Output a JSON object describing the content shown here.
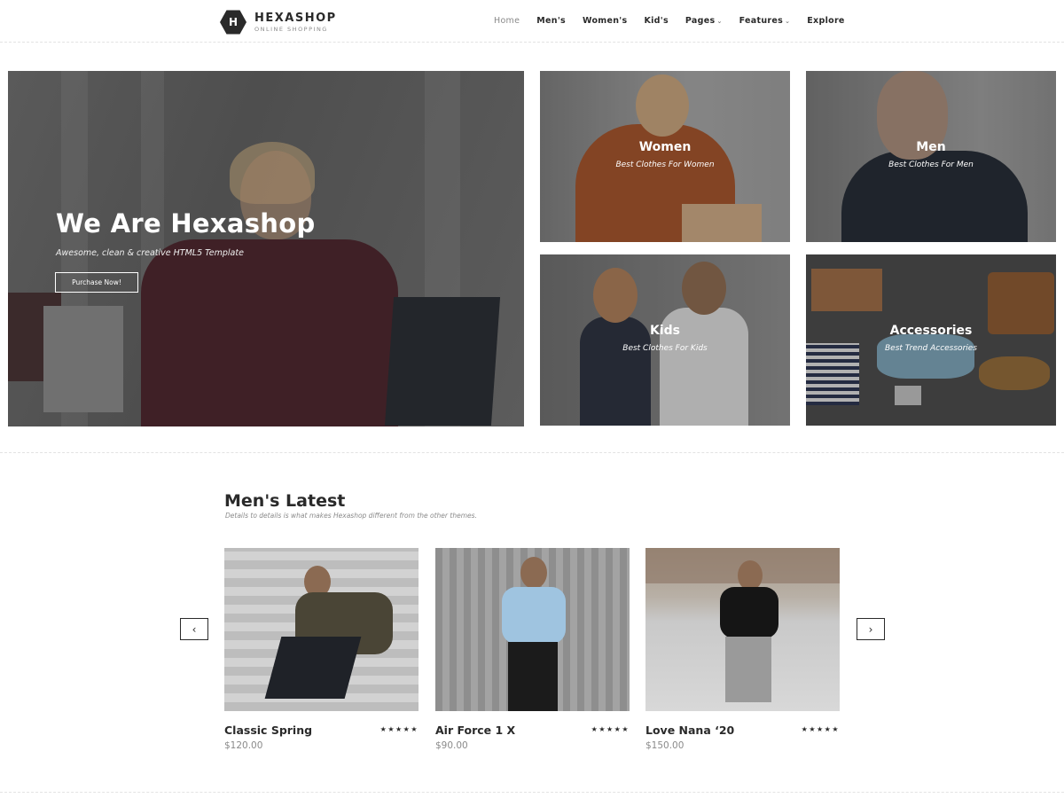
{
  "header": {
    "logo_mark": "H",
    "logo_title": "HEXASHOP",
    "logo_subtitle": "ONLINE SHOPPING",
    "nav": [
      {
        "label": "Home",
        "active": true
      },
      {
        "label": "Men's"
      },
      {
        "label": "Women's"
      },
      {
        "label": "Kid's"
      },
      {
        "label": "Pages",
        "dropdown": true
      },
      {
        "label": "Features",
        "dropdown": true
      },
      {
        "label": "Explore"
      }
    ],
    "caret_glyph": "⌄"
  },
  "hero": {
    "title": "We Are Hexashop",
    "subtitle": "Awesome, clean & creative HTML5 Template",
    "button": "Purchase Now!"
  },
  "categories": [
    {
      "title": "Women",
      "subtitle": "Best Clothes For Women"
    },
    {
      "title": "Men",
      "subtitle": "Best Clothes For Men"
    },
    {
      "title": "Kids",
      "subtitle": "Best Clothes For Kids"
    },
    {
      "title": "Accessories",
      "subtitle": "Best Trend Accessories"
    }
  ],
  "latest": {
    "title": "Men's Latest",
    "subtitle": "Details to details is what makes Hexashop different from the other themes.",
    "prev_glyph": "‹",
    "next_glyph": "›",
    "products": [
      {
        "name": "Classic Spring",
        "price": "$120.00",
        "stars": "★★★★★",
        "rating": 5
      },
      {
        "name": "Air Force 1 X",
        "price": "$90.00",
        "stars": "★★★★★",
        "rating": 5
      },
      {
        "name": "Love Nana ‘20",
        "price": "$150.00",
        "stars": "★★★★★",
        "rating": 5
      }
    ]
  }
}
